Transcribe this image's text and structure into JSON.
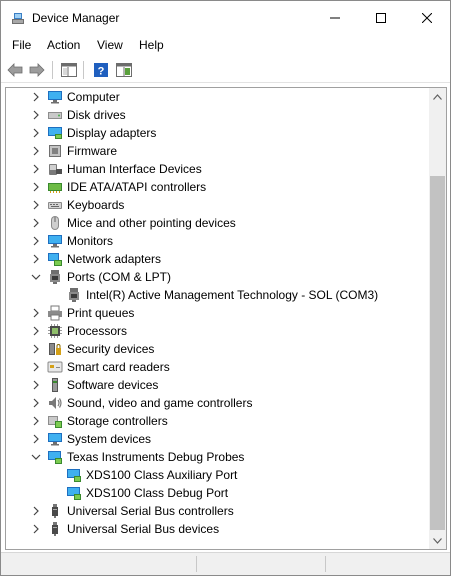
{
  "window": {
    "title": "Device Manager"
  },
  "menu": [
    {
      "label": "File"
    },
    {
      "label": "Action"
    },
    {
      "label": "View"
    },
    {
      "label": "Help"
    }
  ],
  "tree": [
    {
      "label": "Computer",
      "icon": "computer-icon",
      "expanded": false,
      "level": 0
    },
    {
      "label": "Disk drives",
      "icon": "disk-drive-icon",
      "expanded": false,
      "level": 0
    },
    {
      "label": "Display adapters",
      "icon": "display-adapter-icon",
      "expanded": false,
      "level": 0
    },
    {
      "label": "Firmware",
      "icon": "firmware-icon",
      "expanded": false,
      "level": 0
    },
    {
      "label": "Human Interface Devices",
      "icon": "hid-icon",
      "expanded": false,
      "level": 0
    },
    {
      "label": "IDE ATA/ATAPI controllers",
      "icon": "ide-controller-icon",
      "expanded": false,
      "level": 0
    },
    {
      "label": "Keyboards",
      "icon": "keyboard-icon",
      "expanded": false,
      "level": 0
    },
    {
      "label": "Mice and other pointing devices",
      "icon": "mouse-icon",
      "expanded": false,
      "level": 0
    },
    {
      "label": "Monitors",
      "icon": "monitor-icon",
      "expanded": false,
      "level": 0
    },
    {
      "label": "Network adapters",
      "icon": "network-adapter-icon",
      "expanded": false,
      "level": 0
    },
    {
      "label": "Ports (COM & LPT)",
      "icon": "port-icon",
      "expanded": true,
      "level": 0
    },
    {
      "label": "Intel(R) Active Management Technology - SOL (COM3)",
      "icon": "port-icon",
      "level": 1
    },
    {
      "label": "Print queues",
      "icon": "printer-icon",
      "expanded": false,
      "level": 0
    },
    {
      "label": "Processors",
      "icon": "processor-icon",
      "expanded": false,
      "level": 0
    },
    {
      "label": "Security devices",
      "icon": "security-device-icon",
      "expanded": false,
      "level": 0
    },
    {
      "label": "Smart card readers",
      "icon": "smart-card-icon",
      "expanded": false,
      "level": 0
    },
    {
      "label": "Software devices",
      "icon": "software-device-icon",
      "expanded": false,
      "level": 0
    },
    {
      "label": "Sound, video and game controllers",
      "icon": "speaker-icon",
      "expanded": false,
      "level": 0
    },
    {
      "label": "Storage controllers",
      "icon": "storage-controller-icon",
      "expanded": false,
      "level": 0
    },
    {
      "label": "System devices",
      "icon": "system-device-icon",
      "expanded": false,
      "level": 0
    },
    {
      "label": "Texas Instruments Debug Probes",
      "icon": "debug-probe-icon",
      "expanded": true,
      "level": 0
    },
    {
      "label": "XDS100 Class Auxiliary Port",
      "icon": "debug-probe-icon",
      "level": 1
    },
    {
      "label": "XDS100 Class Debug Port",
      "icon": "debug-probe-icon",
      "level": 1
    },
    {
      "label": "Universal Serial Bus controllers",
      "icon": "usb-icon",
      "expanded": false,
      "level": 0
    },
    {
      "label": "Universal Serial Bus devices",
      "icon": "usb-icon",
      "expanded": false,
      "level": 0
    }
  ]
}
